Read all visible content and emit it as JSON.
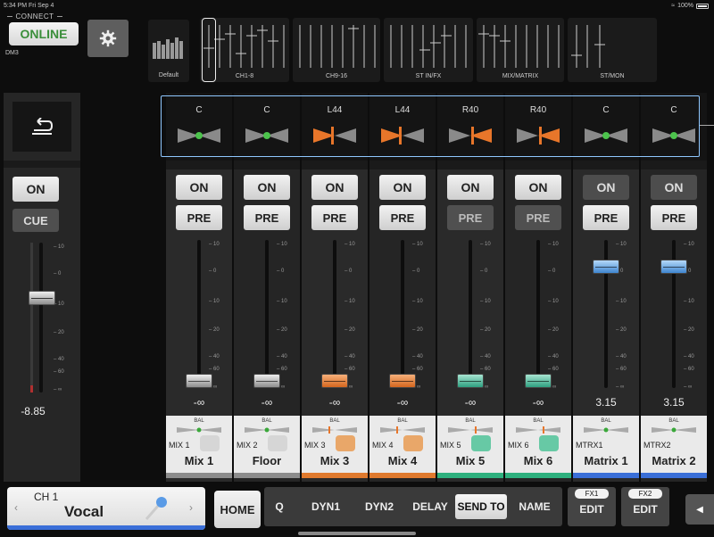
{
  "status": {
    "time": "5:34 PM  Fri Sep 4",
    "battery": "100%"
  },
  "connect": {
    "title": "CONNECT",
    "online_label": "ONLINE",
    "device": "DM3"
  },
  "scene": {
    "label": "Default"
  },
  "nav": [
    {
      "label": "CH1-8"
    },
    {
      "label": "CH9-16"
    },
    {
      "label": "ST IN/FX"
    },
    {
      "label": "MIX/MATRIX"
    },
    {
      "label": "ST/MON"
    }
  ],
  "left_strip": {
    "on_label": "ON",
    "cue_label": "CUE",
    "level": "-8.85",
    "scale": [
      "10",
      "0",
      "10",
      "20",
      "40",
      "60",
      "∞"
    ]
  },
  "scale_labels": [
    "10",
    "0",
    "10",
    "20",
    "40",
    "60",
    "∞"
  ],
  "channels": [
    {
      "pan": "C",
      "on": "ON",
      "on_active": true,
      "pre": "PRE",
      "pre_active": true,
      "level": "-∞",
      "knob": "grey",
      "bal": "BAL",
      "num": "MIX 1",
      "name": "Mix 1",
      "color": "#8c8c8c",
      "icon": "headphone",
      "pan_dir": "center"
    },
    {
      "pan": "C",
      "on": "ON",
      "on_active": true,
      "pre": "PRE",
      "pre_active": true,
      "level": "-∞",
      "knob": "grey",
      "bal": "BAL",
      "num": "MIX 2",
      "name": "Floor",
      "color": "#8c8c8c",
      "icon": "headphone",
      "pan_dir": "center"
    },
    {
      "pan": "L44",
      "on": "ON",
      "on_active": true,
      "pre": "PRE",
      "pre_active": true,
      "level": "-∞",
      "knob": "orange",
      "bal": "BAL",
      "num": "MIX 3",
      "name": "Mix 3",
      "color": "#e07a2e",
      "icon": "monitor-wedge",
      "pan_dir": "left"
    },
    {
      "pan": "L44",
      "on": "ON",
      "on_active": true,
      "pre": "PRE",
      "pre_active": true,
      "level": "-∞",
      "knob": "orange",
      "bal": "BAL",
      "num": "MIX 4",
      "name": "Mix 4",
      "color": "#e07a2e",
      "icon": "monitor-wedge",
      "pan_dir": "left"
    },
    {
      "pan": "R40",
      "on": "ON",
      "on_active": true,
      "pre": "PRE",
      "pre_active": false,
      "level": "-∞",
      "knob": "teal",
      "bal": "BAL",
      "num": "MIX 5",
      "name": "Mix 5",
      "color": "#2eb07e",
      "icon": "speaker",
      "pan_dir": "right"
    },
    {
      "pan": "R40",
      "on": "ON",
      "on_active": true,
      "pre": "PRE",
      "pre_active": false,
      "level": "-∞",
      "knob": "teal",
      "bal": "BAL",
      "num": "MIX 6",
      "name": "Mix 6",
      "color": "#2eb07e",
      "icon": "speaker",
      "pan_dir": "right"
    },
    {
      "pan": "C",
      "on": "ON",
      "on_active": false,
      "pre": "PRE",
      "pre_active": true,
      "level": "3.15",
      "knob": "blue",
      "bal": "BAL",
      "num": "MTRX1",
      "name": "Matrix 1",
      "color": "#3a6fd8",
      "icon": "",
      "pan_dir": "center"
    },
    {
      "pan": "C",
      "on": "ON",
      "on_active": false,
      "pre": "PRE",
      "pre_active": true,
      "level": "3.15",
      "knob": "blue",
      "bal": "BAL",
      "num": "MTRX2",
      "name": "Matrix 2",
      "color": "#3a6fd8",
      "icon": "",
      "pan_dir": "center"
    }
  ],
  "fader_positions": [
    0.95,
    0.95,
    0.95,
    0.95,
    0.95,
    0.95,
    0.18,
    0.18
  ],
  "bottom": {
    "ch_num": "CH 1",
    "ch_name": "Vocal",
    "home_label": "HOME",
    "tabs": [
      "Q",
      "DYN1",
      "DYN2",
      "DELAY",
      "SEND TO",
      "NAME"
    ],
    "active_tab": "SEND TO",
    "fx1_label": "FX1",
    "fx2_label": "FX2",
    "edit_label": "EDIT"
  }
}
